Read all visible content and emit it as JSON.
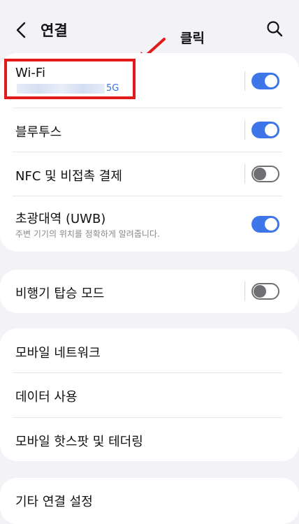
{
  "header": {
    "title": "연결",
    "back_icon": "chevron-left-icon",
    "search_icon": "search-icon"
  },
  "annotation": {
    "click_label": "클릭",
    "highlight_color": "#e31a1a"
  },
  "groups": [
    {
      "items": [
        {
          "label": "Wi-Fi",
          "subtitle": "5G",
          "toggle": true
        },
        {
          "label": "블루투스",
          "toggle": true
        },
        {
          "label": "NFC 및 비접촉 결제",
          "toggle": false
        },
        {
          "label": "초광대역 (UWB)",
          "subtitle": "주변 기기의 위치를 정확하게 알려줍니다.",
          "toggle": true
        }
      ]
    },
    {
      "items": [
        {
          "label": "비행기 탑승 모드",
          "toggle": false
        }
      ]
    },
    {
      "items": [
        {
          "label": "모바일 네트워크"
        },
        {
          "label": "데이터 사용"
        },
        {
          "label": "모바일 핫스팟 및 테더링"
        }
      ]
    },
    {
      "items": [
        {
          "label": "기타 연결 설정"
        }
      ]
    }
  ],
  "colors": {
    "accent": "#3e75e8",
    "toggle_off": "#6f6f74",
    "background": "#f3f2f7"
  }
}
